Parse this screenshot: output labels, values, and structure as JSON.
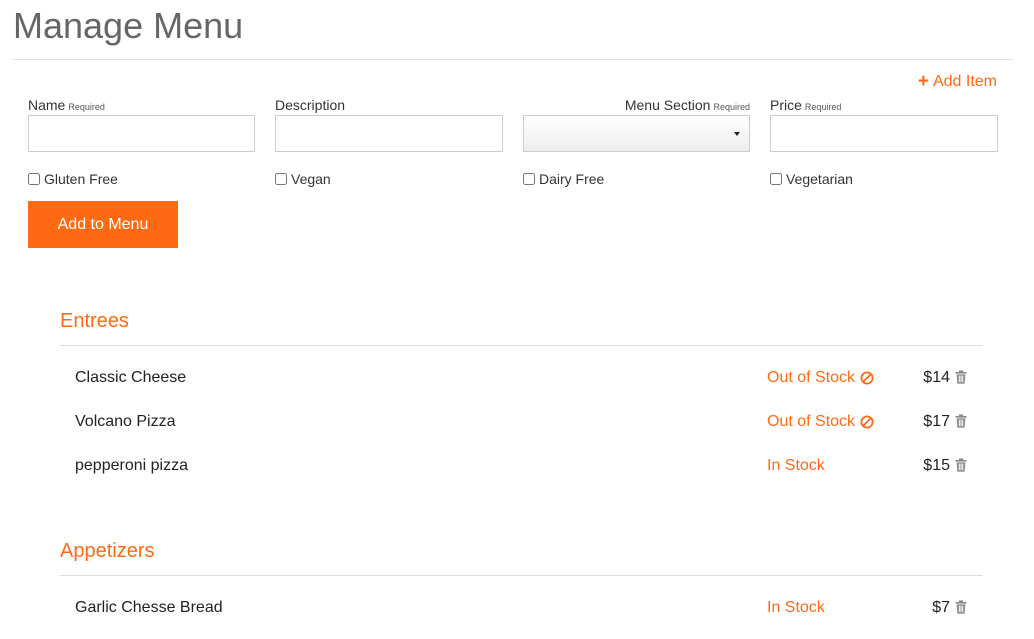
{
  "page": {
    "title": "Manage Menu"
  },
  "toolbar": {
    "add_item_label": "Add Item"
  },
  "form": {
    "name": {
      "label": "Name",
      "required": "Required",
      "value": ""
    },
    "description": {
      "label": "Description",
      "value": ""
    },
    "menu_section": {
      "label": "Menu Section",
      "required": "Required",
      "value": ""
    },
    "price": {
      "label": "Price",
      "required": "Required",
      "value": ""
    },
    "checkboxes": [
      {
        "label": "Gluten Free",
        "checked": false
      },
      {
        "label": "Vegan",
        "checked": false
      },
      {
        "label": "Dairy Free",
        "checked": false
      },
      {
        "label": "Vegetarian",
        "checked": false
      }
    ],
    "submit_label": "Add to Menu"
  },
  "sections": [
    {
      "title": "Entrees",
      "items": [
        {
          "name": "Classic Cheese",
          "stock": "Out of Stock",
          "in_stock": false,
          "price": "$14"
        },
        {
          "name": "Volcano Pizza",
          "stock": "Out of Stock",
          "in_stock": false,
          "price": "$17"
        },
        {
          "name": "pepperoni pizza",
          "stock": "In Stock",
          "in_stock": true,
          "price": "$15"
        }
      ]
    },
    {
      "title": "Appetizers",
      "items": [
        {
          "name": "Garlic Chesse Bread",
          "stock": "In Stock",
          "in_stock": true,
          "price": "$7"
        }
      ]
    }
  ],
  "colors": {
    "accent": "#ff6a13",
    "title": "#666666",
    "text": "#222222",
    "divider": "#dddddd"
  },
  "icons": {
    "add": "plus-icon",
    "out_of_stock": "ban-icon",
    "delete": "trash-icon",
    "select": "caret-down-icon"
  }
}
